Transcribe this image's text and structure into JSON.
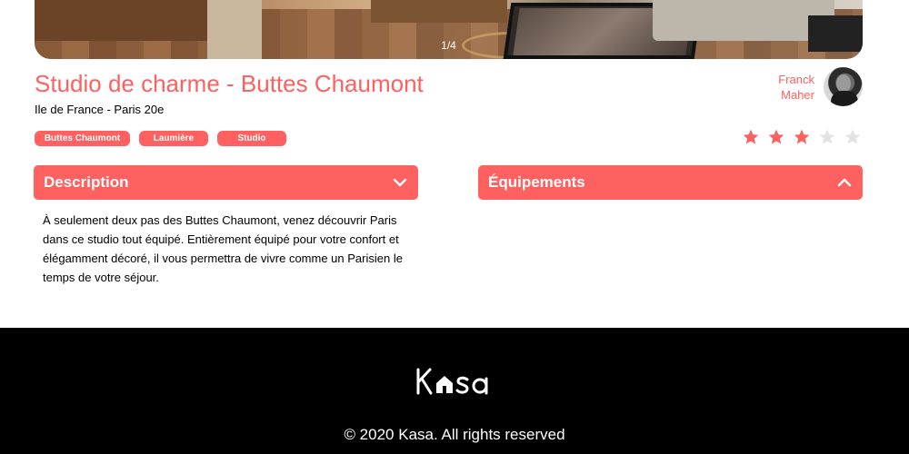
{
  "gallery": {
    "counter": "1/4"
  },
  "listing": {
    "title": "Studio de charme - Buttes Chaumont",
    "location": "Ile de France - Paris 20e",
    "tags": [
      "Buttes Chaumont",
      "Laumière",
      "Studio"
    ],
    "rating": 3,
    "rating_max": 5
  },
  "host": {
    "first_name": "Franck",
    "last_name": "Maher"
  },
  "sections": {
    "description": {
      "title": "Description",
      "expanded": true,
      "body": "À seulement deux pas des Buttes Chaumont, venez découvrir Paris dans ce studio tout équipé. Entièrement équipé pour votre confort et élégamment décoré, il vous permettra de vivre comme un Parisien le temps de votre séjour."
    },
    "equipements": {
      "title": "Équipements",
      "expanded": false
    }
  },
  "footer": {
    "logo_text": "Kasa",
    "copyright": "© 2020 Kasa. All rights reserved"
  },
  "colors": {
    "accent": "#ff6060",
    "star_off": "#e3e3e3",
    "footer_bg": "#000000"
  },
  "icons": {
    "collapse_open": "chevron-down-icon",
    "collapse_closed": "chevron-up-icon",
    "star": "star-icon"
  }
}
